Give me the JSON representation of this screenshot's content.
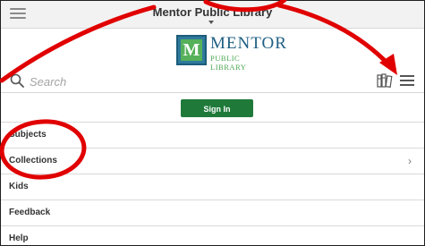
{
  "topbar": {
    "title": "Mentor Public Library"
  },
  "logo": {
    "mark_letter": "M",
    "name": "MENTOR",
    "subtitle": "PUBLIC LIBRARY"
  },
  "search": {
    "placeholder": "Search"
  },
  "signin": {
    "label": "Sign In"
  },
  "nav": {
    "items": [
      {
        "label": "Subjects"
      },
      {
        "label": "Collections",
        "chevron": "›"
      },
      {
        "label": "Kids"
      },
      {
        "label": "Feedback"
      },
      {
        "label": "Help"
      }
    ]
  },
  "icons": {
    "top_menu": "hamburger-icon",
    "search": "search-icon",
    "bookshelf": "bookshelf-icon",
    "menu": "menu-icon"
  },
  "colors": {
    "signin_button": "#1f7a3a",
    "brand_blue": "#1e5f84",
    "brand_green": "#4aa650",
    "annotation_red": "#e10000"
  }
}
